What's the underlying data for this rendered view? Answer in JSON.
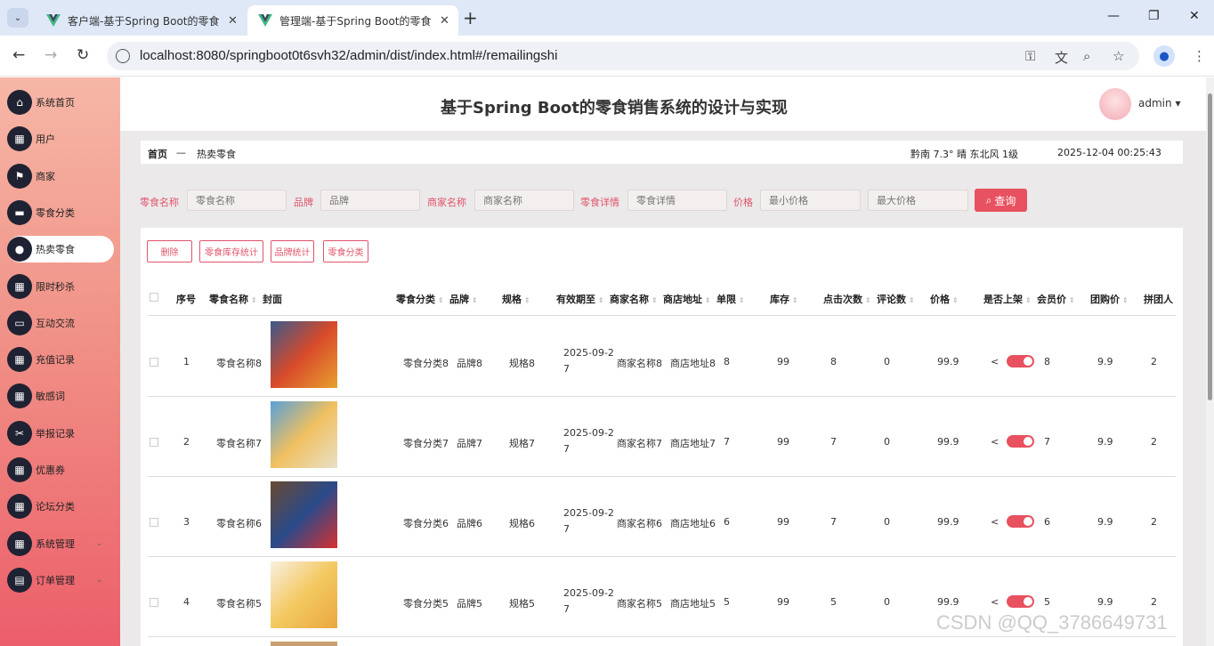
{
  "browser": {
    "tabs": [
      {
        "title": "客户端-基于Spring Boot的零食",
        "active": false
      },
      {
        "title": "管理端-基于Spring Boot的零食",
        "active": true
      }
    ],
    "url": "localhost:8080/springboot0t6svh32/admin/dist/index.html#/remailingshi"
  },
  "sidebar": {
    "items": [
      {
        "label": "系统首页",
        "icon": "home-icon",
        "active": false
      },
      {
        "label": "用户",
        "icon": "grid-icon",
        "active": false
      },
      {
        "label": "商家",
        "icon": "flag-icon",
        "active": false
      },
      {
        "label": "零食分类",
        "icon": "briefcase-icon",
        "active": false
      },
      {
        "label": "热卖零食",
        "icon": "user-icon",
        "active": true
      },
      {
        "label": "限时秒杀",
        "icon": "grid-icon",
        "active": false
      },
      {
        "label": "互动交流",
        "icon": "wallet-icon",
        "active": false
      },
      {
        "label": "充值记录",
        "icon": "grid-icon",
        "active": false
      },
      {
        "label": "敏感词",
        "icon": "grid-icon",
        "active": false
      },
      {
        "label": "举报记录",
        "icon": "ticket-icon",
        "active": false
      },
      {
        "label": "优惠券",
        "icon": "grid-icon",
        "active": false
      },
      {
        "label": "论坛分类",
        "icon": "grid-icon",
        "active": false
      },
      {
        "label": "系统管理",
        "icon": "grid-icon",
        "active": false,
        "expandable": true
      },
      {
        "label": "订单管理",
        "icon": "clipboard-icon",
        "active": false,
        "expandable": true
      }
    ]
  },
  "header": {
    "title": "基于Spring Boot的零食销售系统的设计与实现",
    "user": "admin"
  },
  "breadcrumb": {
    "home": "首页",
    "sep": "—",
    "current": "热卖零食"
  },
  "status": {
    "weather": "黔南  7.3°  晴  东北风  1级",
    "datetime": "2025-12-04 00:25:43"
  },
  "search": {
    "fields": [
      {
        "label": "零食名称",
        "placeholder": "零食名称"
      },
      {
        "label": "品牌",
        "placeholder": "品牌"
      },
      {
        "label": "商家名称",
        "placeholder": "商家名称"
      },
      {
        "label": "零食详情",
        "placeholder": "零食详情"
      },
      {
        "label": "价格",
        "placeholder": "最小价格"
      },
      {
        "label": "",
        "placeholder": "最大价格"
      }
    ],
    "button": "查询"
  },
  "actions": [
    "删除",
    "零食库存统计",
    "品牌统计",
    "零食分类"
  ],
  "table": {
    "headers": [
      "序号",
      "零食名称",
      "封面",
      "零食分类",
      "品牌",
      "规格",
      "有效期至",
      "商家名称",
      "商店地址",
      "单限",
      "库存",
      "点击次数",
      "评论数",
      "价格",
      "是否上架",
      "会员价",
      "团购价",
      "拼团人"
    ],
    "rows": [
      {
        "no": "1",
        "name": "零食名称8",
        "category": "零食分类8",
        "brand": "品牌8",
        "spec": "规格8",
        "expiry1": "2025-09-2",
        "expiry2": "7",
        "shop": "商家名称8",
        "addr": "商店地址8",
        "limit": "8",
        "stock": "99",
        "clicks": "8",
        "comments": "0",
        "price": "99.9",
        "vip": "8",
        "group": "9.9",
        "groupn": "2"
      },
      {
        "no": "2",
        "name": "零食名称7",
        "category": "零食分类7",
        "brand": "品牌7",
        "spec": "规格7",
        "expiry1": "2025-09-2",
        "expiry2": "7",
        "shop": "商家名称7",
        "addr": "商店地址7",
        "limit": "7",
        "stock": "99",
        "clicks": "7",
        "comments": "0",
        "price": "99.9",
        "vip": "7",
        "group": "9.9",
        "groupn": "2"
      },
      {
        "no": "3",
        "name": "零食名称6",
        "category": "零食分类6",
        "brand": "品牌6",
        "spec": "规格6",
        "expiry1": "2025-09-2",
        "expiry2": "7",
        "shop": "商家名称6",
        "addr": "商店地址6",
        "limit": "6",
        "stock": "99",
        "clicks": "7",
        "comments": "0",
        "price": "99.9",
        "vip": "6",
        "group": "9.9",
        "groupn": "2"
      },
      {
        "no": "4",
        "name": "零食名称5",
        "category": "零食分类5",
        "brand": "品牌5",
        "spec": "规格5",
        "expiry1": "2025-09-2",
        "expiry2": "7",
        "shop": "商家名称5",
        "addr": "商店地址5",
        "limit": "5",
        "stock": "99",
        "clicks": "5",
        "comments": "0",
        "price": "99.9",
        "vip": "5",
        "group": "9.9",
        "groupn": "2"
      }
    ]
  },
  "watermark": "CSDN @QQ_3786649731",
  "colors": {
    "accent": "#e8515f",
    "sidebar_top": "#f6b7a6",
    "sidebar_bottom": "#ec5e6a"
  }
}
